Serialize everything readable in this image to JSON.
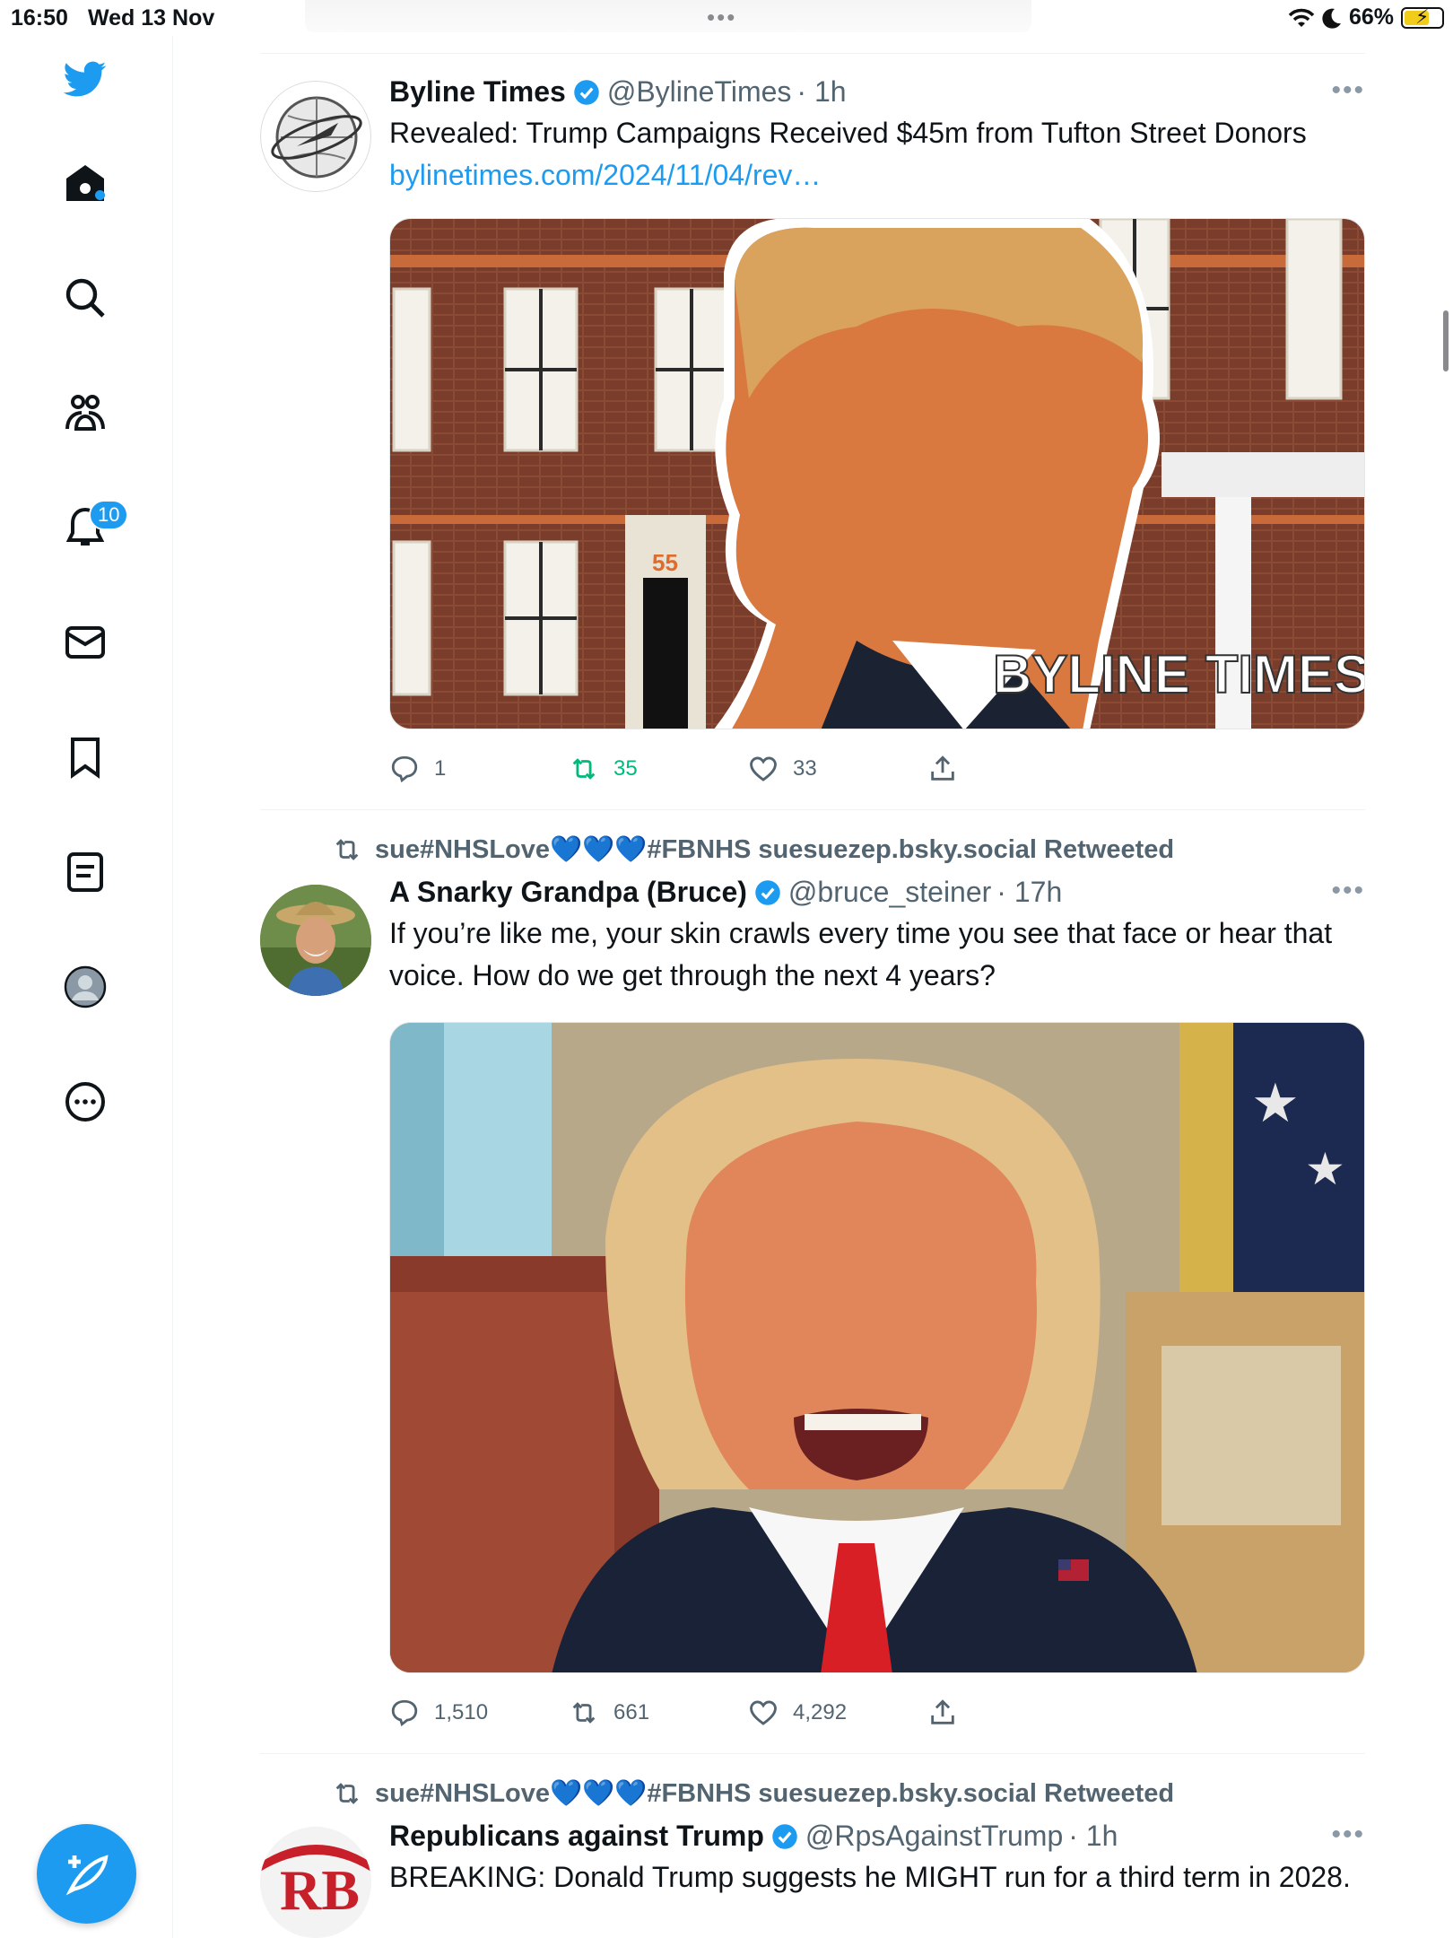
{
  "status": {
    "time": "16:50",
    "date": "Wed 13 Nov",
    "battery": "66%"
  },
  "sidebar": {
    "notifications_badge": "10"
  },
  "tweets": [
    {
      "name": "Byline Times",
      "handle": "@BylineTimes",
      "time": "· 1h",
      "text": "Revealed: Trump Campaigns Received $45m from Tufton Street Donors",
      "link": "bylinetimes.com/2024/11/04/rev…",
      "media_caption": "BYLINE TIMES",
      "replies": "1",
      "retweets": "35",
      "likes": "33"
    },
    {
      "retweeted_by": "sue#NHSLove💙💙💙#FBNHS suesuezep.bsky.social Retweeted",
      "name": "A Snarky Grandpa (Bruce)",
      "handle": "@bruce_steiner",
      "time": "· 17h",
      "text": "If you’re like me, your skin crawls every time you see that face or hear that voice. How do we get through the next 4 years?",
      "replies": "1,510",
      "retweets": "661",
      "likes": "4,292"
    },
    {
      "retweeted_by": "sue#NHSLove💙💙💙#FBNHS suesuezep.bsky.social Retweeted",
      "name": "Republicans against Trump",
      "handle": "@RpsAgainstTrump",
      "time": "· 1h",
      "text": "BREAKING: Donald Trump suggests he MIGHT run for a third term in 2028.",
      "avatar_text": "RB"
    }
  ],
  "icons": {
    "brand": "twitter-bird-icon",
    "nav": [
      "home-icon",
      "search-icon",
      "communities-icon",
      "notifications-icon",
      "messages-icon",
      "bookmarks-icon",
      "lists-icon",
      "profile-icon",
      "more-options-icon"
    ],
    "compose": "compose-icon"
  },
  "colors": {
    "accent": "#1d9bf0",
    "retweet_green": "#00ba7c",
    "muted": "#536471"
  }
}
